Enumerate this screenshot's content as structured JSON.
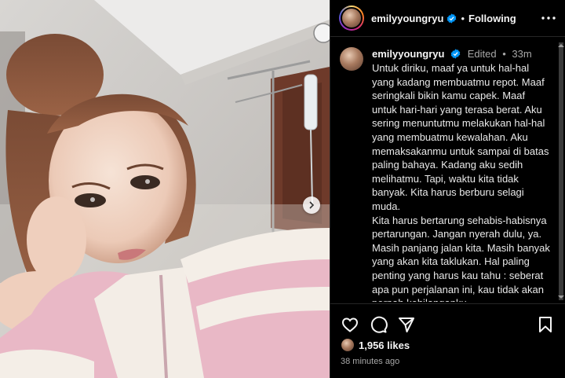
{
  "header": {
    "username": "emilyyoungryu",
    "separator": "•",
    "follow_label": "Following"
  },
  "caption": {
    "username": "emilyyoungryu",
    "edited": "Edited",
    "separator": "•",
    "age": "33m",
    "paragraphs": [
      "Untuk diriku, maaf ya untuk hal-hal yang kadang membuatmu repot. Maaf seringkali bikin kamu capek. Maaf untuk hari-hari yang terasa berat. Aku sering menuntutmu melakukan hal-hal yang membuatmu kewalahan. Aku memaksakanmu untuk sampai di batas paling bahaya. Kadang aku sedih melihatmu. Tapi, waktu kita tidak banyak. Kita harus berburu selagi muda.",
      "Kita harus bertarung sehabis-habisnya pertarungan. Jangan nyerah dulu, ya. Masih panjang jalan kita. Masih banyak yang akan kita taklukan. Hal paling penting yang harus kau tahu : seberat apa pun perjalanan ini, kau tidak akan pernah kehilanganku."
    ],
    "more": "...."
  },
  "footer": {
    "likes": "1,956 likes",
    "posted": "38 minutes ago"
  },
  "icons": {
    "verified": "verified-badge-icon",
    "more": "more-horizontal-icon",
    "like": "heart-icon",
    "comment": "comment-icon",
    "share": "send-icon",
    "save": "bookmark-icon",
    "next": "chevron-right-icon"
  },
  "colors": {
    "verified": "#0095f6",
    "background": "#000000",
    "muted_text": "#a8a8a8",
    "divider": "#262626"
  }
}
